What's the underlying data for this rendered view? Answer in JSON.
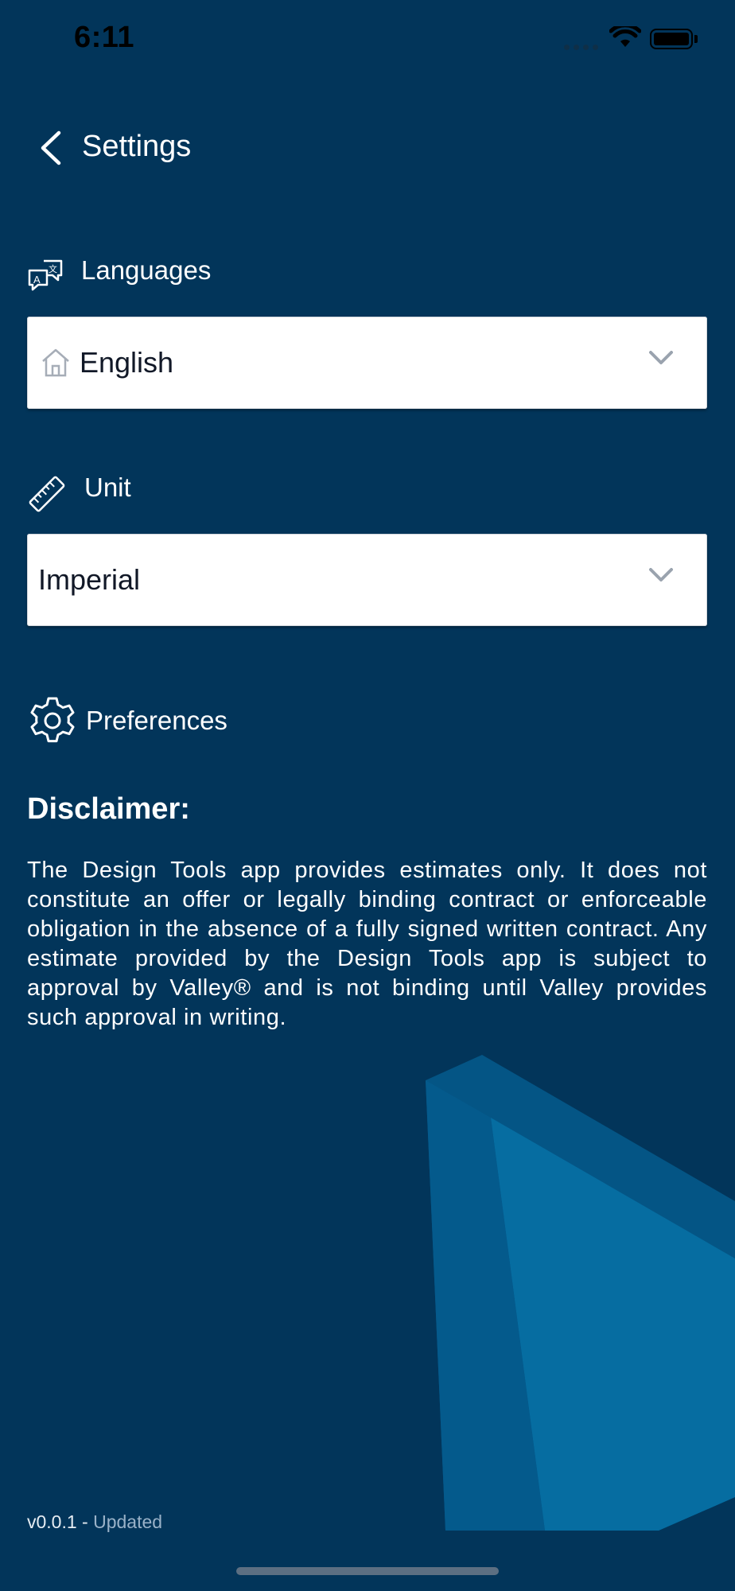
{
  "status_bar": {
    "time": "6:11"
  },
  "header": {
    "back_icon": "chevron-left-icon",
    "title": "Settings"
  },
  "languages": {
    "label": "Languages",
    "icon": "translate-icon",
    "selected_icon": "home-icon",
    "selected": "English"
  },
  "unit": {
    "label": "Unit",
    "icon": "ruler-icon",
    "selected": "Imperial"
  },
  "preferences": {
    "label": "Preferences",
    "icon": "gear-icon"
  },
  "disclaimer": {
    "title": "Disclaimer:",
    "text": "The Design Tools app provides estimates only. It does not constitute an offer or legally binding contract or enforceable obligation in the absence of a fully signed written contract. Any estimate provided by the Design Tools app is subject to approval by Valley® and is not binding until Valley provides such approval in writing."
  },
  "footer": {
    "version": "v0.0.1 -",
    "status": "Updated"
  },
  "colors": {
    "background": "#02355a",
    "accent_light": "#0a6fa3",
    "accent_mid": "#045585"
  }
}
